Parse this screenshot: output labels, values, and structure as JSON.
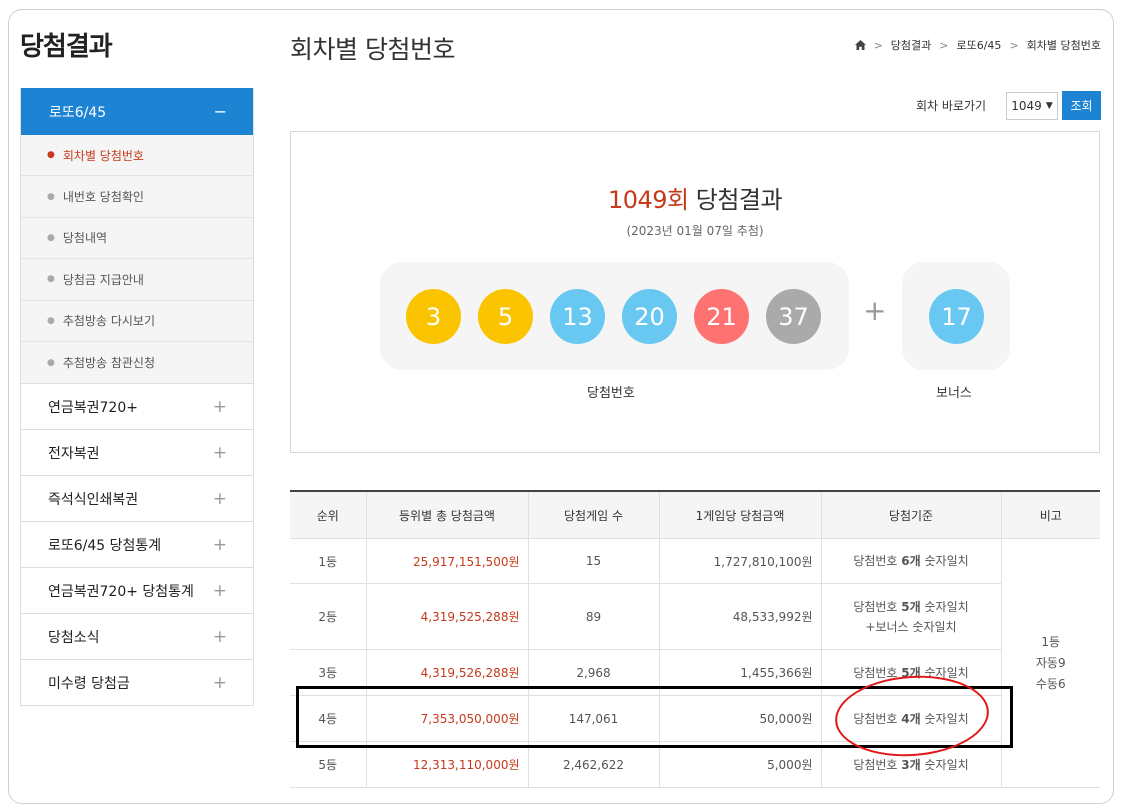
{
  "sidebar": {
    "title": "당첨결과",
    "active": {
      "label": "로또6/45",
      "symbol": "−"
    },
    "sub_items": [
      {
        "label": "회차별 당첨번호",
        "current": true
      },
      {
        "label": "내번호 당첨확인"
      },
      {
        "label": "당첨내역"
      },
      {
        "label": "당첨금 지급안내"
      },
      {
        "label": "추첨방송 다시보기"
      },
      {
        "label": "추첨방송 참관신청"
      }
    ],
    "items": [
      {
        "label": "연금복권720+"
      },
      {
        "label": "전자복권"
      },
      {
        "label": "즉석식인쇄복권"
      },
      {
        "label": "로또6/45 당첨통계"
      },
      {
        "label": "연금복권720+ 당첨통계"
      },
      {
        "label": "당첨소식"
      },
      {
        "label": "미수령 당첨금"
      }
    ]
  },
  "header": {
    "title": "회차별 당첨번호",
    "breadcrumb": [
      "당첨결과",
      "로또6/45",
      "회차별 당첨번호"
    ]
  },
  "goto": {
    "label": "회차 바로가기",
    "selected": "1049",
    "button": "조회"
  },
  "result": {
    "round": "1049회",
    "title_suffix": " 당첨결과",
    "date": "(2023년 01월 07일 추첨)",
    "numbers": [
      {
        "value": "3",
        "color": "#fbc400"
      },
      {
        "value": "5",
        "color": "#fbc400"
      },
      {
        "value": "13",
        "color": "#69c8f2"
      },
      {
        "value": "20",
        "color": "#69c8f2"
      },
      {
        "value": "21",
        "color": "#ff7272"
      },
      {
        "value": "37",
        "color": "#aaaaaa"
      }
    ],
    "bonus": {
      "value": "17",
      "color": "#69c8f2"
    },
    "plus": "+",
    "main_label": "당첨번호",
    "bonus_label": "보너스"
  },
  "table": {
    "headers": [
      "순위",
      "등위별 총 당첨금액",
      "당첨게임 수",
      "1게임당 당첨금액",
      "당첨기준",
      "비고"
    ],
    "rows": [
      {
        "rank": "1등",
        "total": "25,917,151,500원",
        "count": "15",
        "per": "1,727,810,100원",
        "crit_a": "당첨번호 ",
        "crit_b": "6개",
        "crit_c": " 숫자일치",
        "crit_extra": ""
      },
      {
        "rank": "2등",
        "total": "4,319,525,288원",
        "count": "89",
        "per": "48,533,992원",
        "crit_a": "당첨번호 ",
        "crit_b": "5개",
        "crit_c": " 숫자일치",
        "crit_extra": "+보너스 숫자일치"
      },
      {
        "rank": "3등",
        "total": "4,319,526,288원",
        "count": "2,968",
        "per": "1,455,366원",
        "crit_a": "당첨번호 ",
        "crit_b": "5개",
        "crit_c": " 숫자일치",
        "crit_extra": ""
      },
      {
        "rank": "4등",
        "total": "7,353,050,000원",
        "count": "147,061",
        "per": "50,000원",
        "crit_a": "당첨번호 ",
        "crit_b": "4개",
        "crit_c": " 숫자일치",
        "crit_extra": ""
      },
      {
        "rank": "5등",
        "total": "12,313,110,000원",
        "count": "2,462,622",
        "per": "5,000원",
        "crit_a": "당첨번호 ",
        "crit_b": "3개",
        "crit_c": " 숫자일치",
        "crit_extra": ""
      }
    ],
    "note": [
      "1등",
      "자동9",
      "수동6"
    ]
  },
  "colors": {
    "accent": "#1d84d4",
    "highlight": "#c63a1a",
    "annotation_circle": "#e01818"
  }
}
